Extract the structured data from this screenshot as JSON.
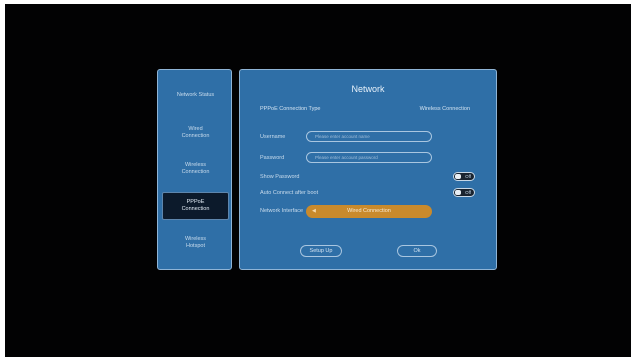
{
  "sidebar": {
    "items": [
      {
        "label": "Network Status"
      },
      {
        "label": "Wired Connection"
      },
      {
        "label": "Wireless Connection"
      },
      {
        "label": "PPPoE Connection"
      },
      {
        "label": "Wireless Hotspot"
      }
    ],
    "active_index": 3
  },
  "panel": {
    "title": "Network",
    "connection_type_label": "PPPoE Connection Type",
    "connection_type_value": "Wireless Connection",
    "username": {
      "label": "Username",
      "value": "",
      "placeholder": "Please enter account name"
    },
    "password": {
      "label": "Password",
      "value": "",
      "placeholder": "Please enter account password"
    },
    "show_password": {
      "label": "Show Password",
      "state": "Off"
    },
    "auto_connect": {
      "label": "Auto Connect after boot",
      "state": "Off"
    },
    "network_interface": {
      "label": "Network Interface",
      "value": "Wired Connection"
    },
    "setup_button": "Setup Up",
    "ok_button": "Ok"
  },
  "colors": {
    "background": "#020203",
    "panel": "#2f6fa7",
    "panel_border": "#8fb4d6",
    "accent": "#c98a2c",
    "active_item": "#0c1a2b"
  }
}
